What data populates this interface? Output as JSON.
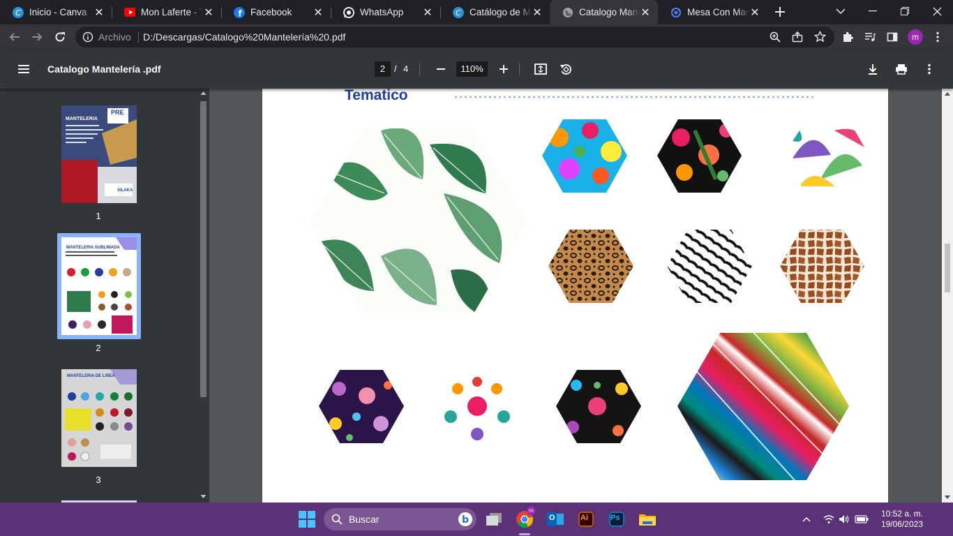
{
  "browser": {
    "tabs": [
      {
        "title": "Inicio - Canva",
        "icon": "canva-icon"
      },
      {
        "title": "Mon Laferte - Tu",
        "icon": "youtube-icon"
      },
      {
        "title": "Facebook",
        "icon": "facebook-icon"
      },
      {
        "title": "WhatsApp",
        "icon": "whatsapp-icon"
      },
      {
        "title": "Catálogo de Man",
        "icon": "canva-icon"
      },
      {
        "title": "Catalogo Mantele",
        "icon": "globe-icon",
        "active": true
      },
      {
        "title": "Mesa Con Mante",
        "icon": "extension-icon"
      }
    ],
    "address": {
      "chip": "Archivo",
      "url": "D:/Descargas/Catalogo%20Mantelería%20.pdf"
    },
    "profile_initial": "m"
  },
  "pdf": {
    "title": "Catalogo Mantelería .pdf",
    "current_page": "2",
    "separator": "/",
    "total_pages": "4",
    "zoom": "110%",
    "thumbnails": [
      {
        "label": "1",
        "heading": "MANTELERIA",
        "badge": "PRE",
        "logo": "SILAKA"
      },
      {
        "label": "2",
        "heading": "MANTELERIA SUBLIMADA"
      },
      {
        "label": "3",
        "heading": "MANTELERIA DE LINEA"
      }
    ],
    "page_heading": "Tematico"
  },
  "taskbar": {
    "search_placeholder": "Buscar",
    "time": "10:52 a. m.",
    "date": "19/06/2023",
    "avatar_initial": "m",
    "illustrator_label": "Ai",
    "photoshop_label": "Ps",
    "outlook_label": "O"
  },
  "colors": {
    "tabstrip": "#202124",
    "toolbar": "#35363a",
    "pdf_toolbar": "#323639",
    "viewer_bg": "#525659",
    "taskbar": "#5b3278",
    "heading_blue": "#1f3f9c",
    "profile": "#9c27b0"
  }
}
